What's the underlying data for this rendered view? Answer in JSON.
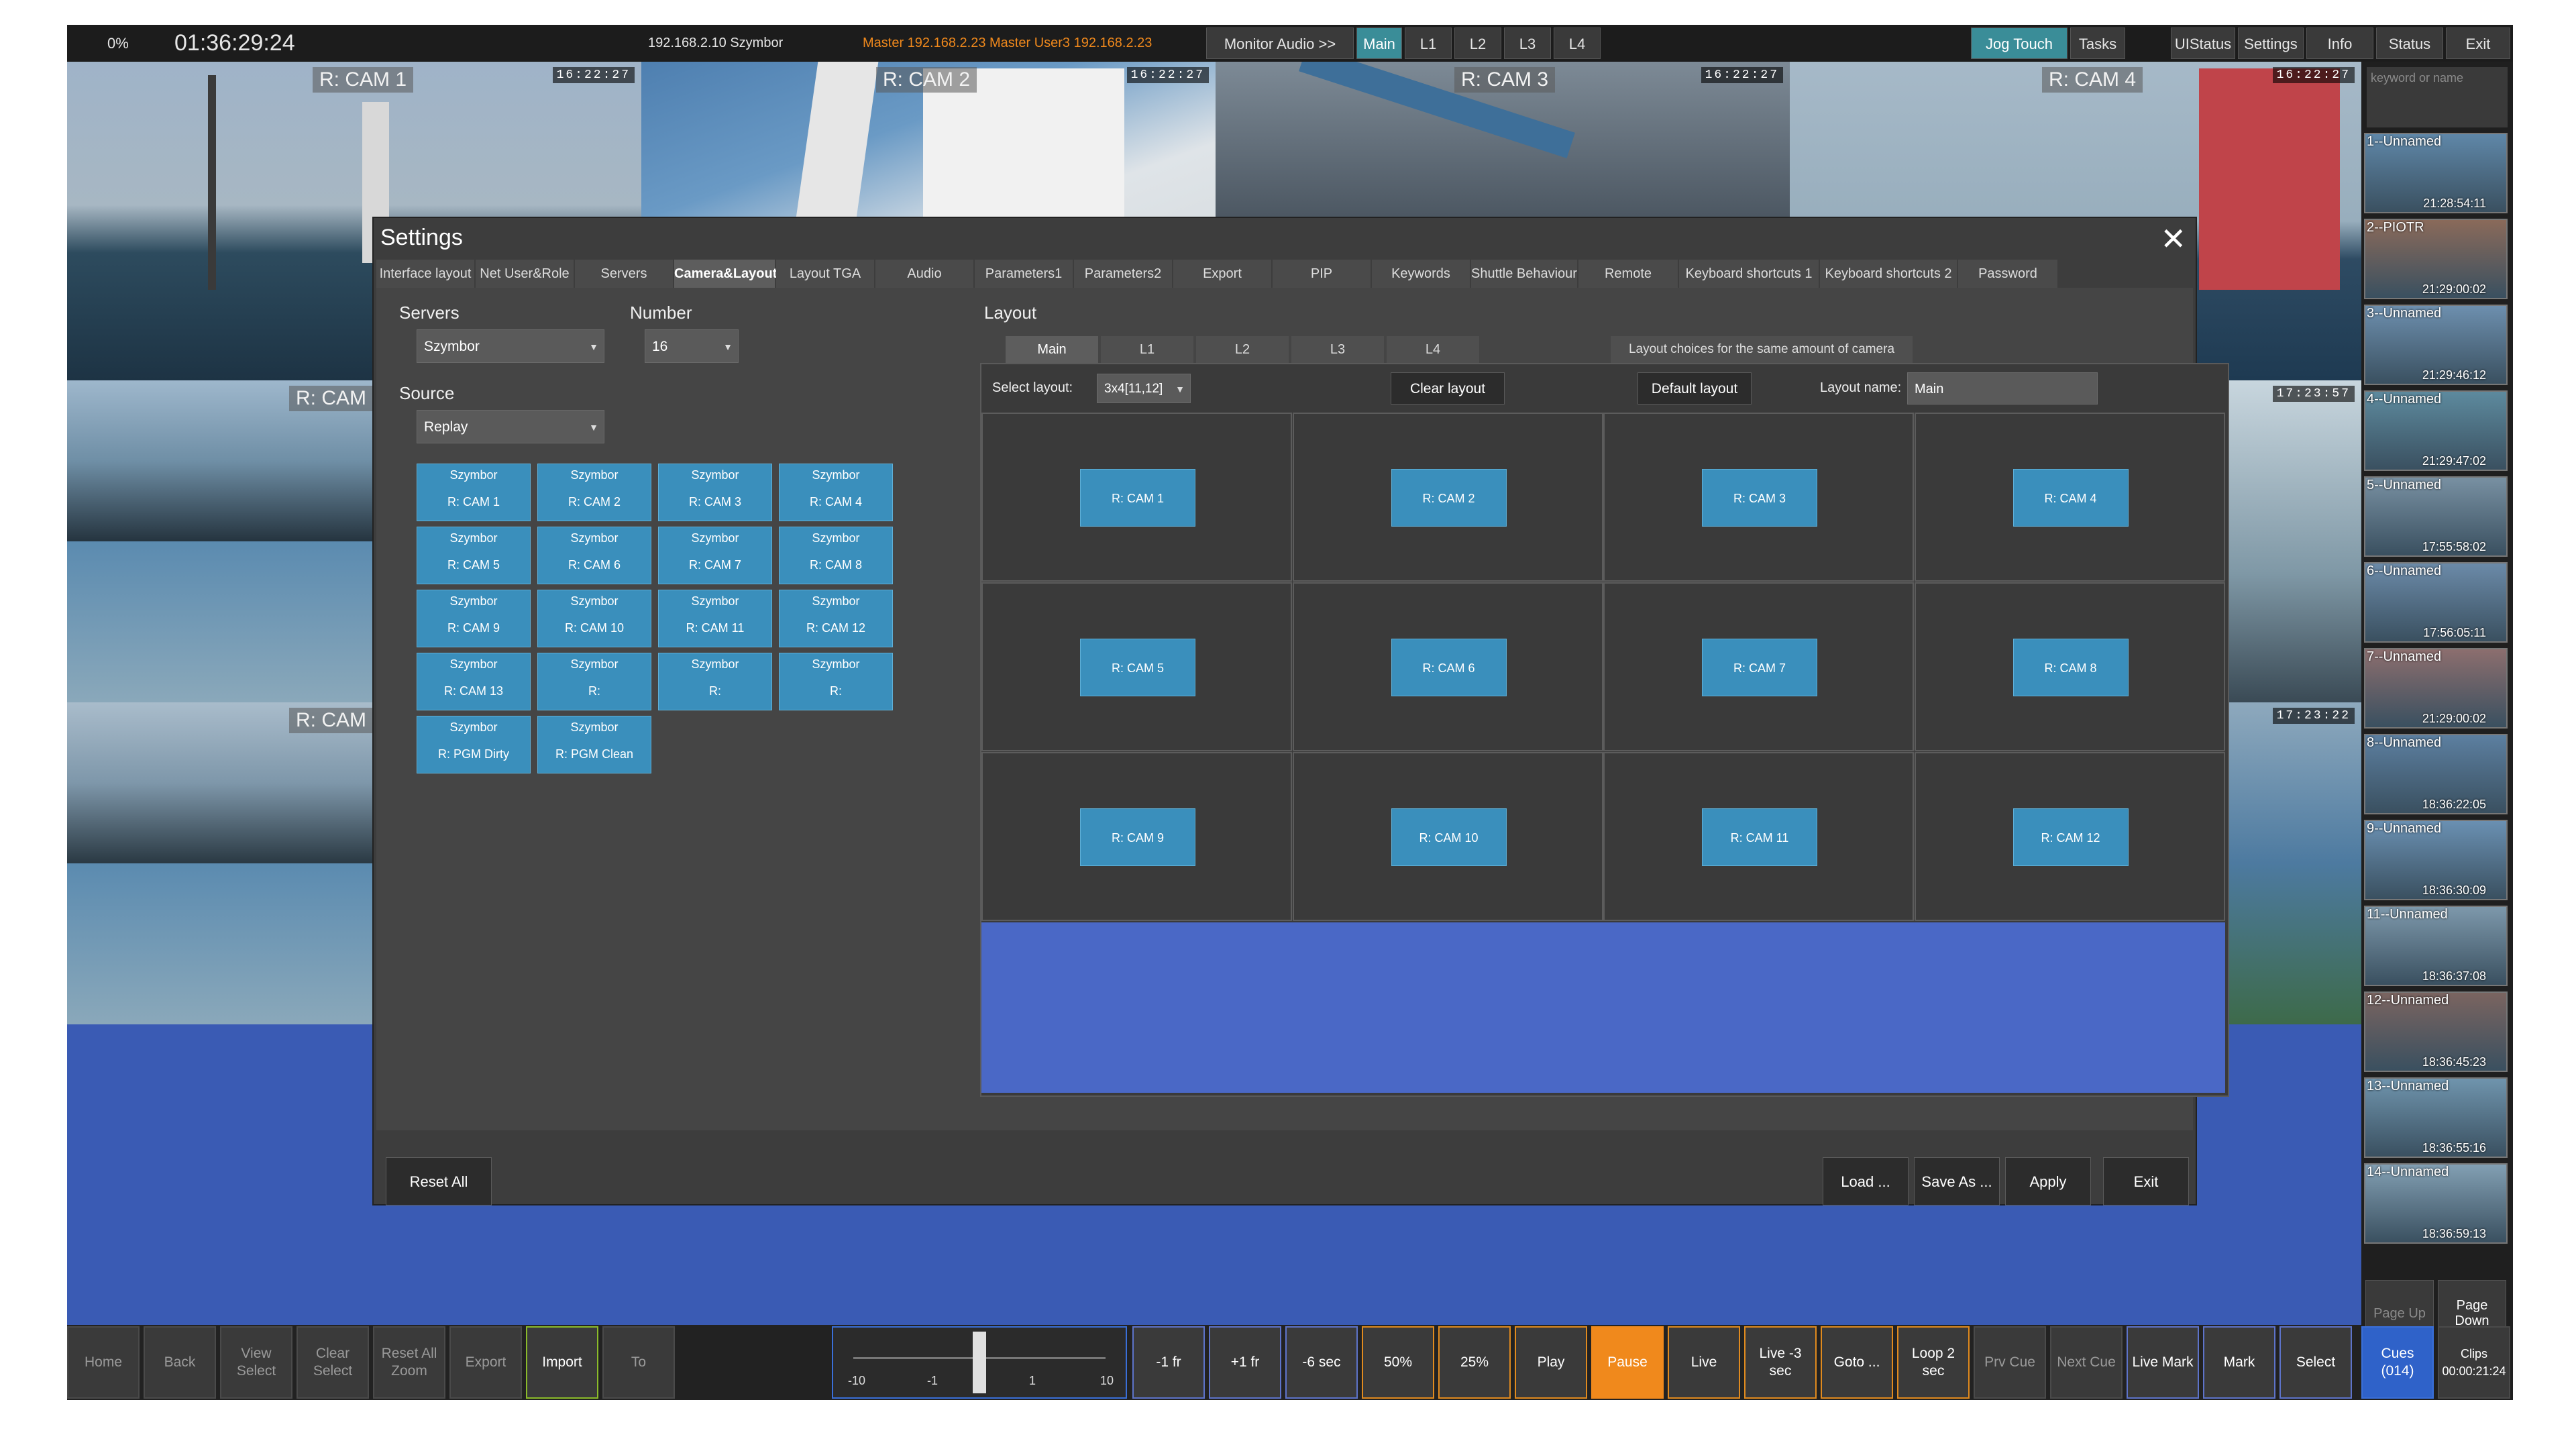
{
  "topbar": {
    "percent": "0%",
    "timecode": "01:36:29:24",
    "server": "192.168.2.10 Szymbor",
    "master": "Master 192.168.2.23  Master  User3  192.168.2.23",
    "buttons": [
      "Monitor Audio >>",
      "Main",
      "L1",
      "L2",
      "L3",
      "L4"
    ],
    "right_buttons": [
      "Jog Touch",
      "Tasks",
      "UIStatus",
      "Settings",
      "Info",
      "Status",
      "Exit"
    ]
  },
  "cameras": {
    "cam1": "R: CAM 1",
    "cam2": "R: CAM 2",
    "cam3": "R: CAM 3",
    "cam4": "R: CAM 4",
    "left_mid": "R: CAM",
    "left_low": "R: CAM",
    "tc1": "16:22:27",
    "tc2": "16:22:27",
    "tc3": "16:22:27",
    "tc4": "16:22:27",
    "tc_r1": "17:23:57",
    "tc_r2": "17:23:22"
  },
  "clips": {
    "keyword_placeholder": "keyword or name",
    "items": [
      {
        "name": "1--Unnamed",
        "time": "21:28:54:11"
      },
      {
        "name": "2--PIOTR",
        "time": "21:29:00:02"
      },
      {
        "name": "3--Unnamed",
        "time": "21:29:46:12"
      },
      {
        "name": "4--Unnamed",
        "time": "21:29:47:02"
      },
      {
        "name": "5--Unnamed",
        "time": "17:55:58:02"
      },
      {
        "name": "6--Unnamed",
        "time": "17:56:05:11"
      },
      {
        "name": "7--Unnamed",
        "time": "21:29:00:02"
      },
      {
        "name": "8--Unnamed",
        "time": "18:36:22:05"
      },
      {
        "name": "9--Unnamed",
        "time": "18:36:30:09"
      },
      {
        "name": "11--Unnamed",
        "time": "18:36:37:08"
      },
      {
        "name": "12--Unnamed",
        "time": "18:36:45:23"
      },
      {
        "name": "13--Unnamed",
        "time": "18:36:55:16"
      },
      {
        "name": "14--Unnamed",
        "time": "18:36:59:13"
      }
    ],
    "page_up": "Page Up",
    "page_down": "Page Down"
  },
  "settings": {
    "title": "Settings",
    "tabs": [
      "Interface layout",
      "Net User&Role",
      "Servers",
      "Camera&Layout",
      "Layout TGA",
      "Audio",
      "Parameters1",
      "Parameters2",
      "Export",
      "PIP",
      "Keywords",
      "Shuttle Behaviour",
      "Remote",
      "Keyboard shortcuts 1",
      "Keyboard shortcuts 2",
      "Password"
    ],
    "active_tab": "Camera&Layout",
    "servers_label": "Servers",
    "servers_value": "Szymbor",
    "number_label": "Number",
    "number_value": "16",
    "source_label": "Source",
    "source_value": "Replay",
    "sources": [
      {
        "server": "Szymbor",
        "cam": "R: CAM 1"
      },
      {
        "server": "Szymbor",
        "cam": "R: CAM 2"
      },
      {
        "server": "Szymbor",
        "cam": "R: CAM 3"
      },
      {
        "server": "Szymbor",
        "cam": "R: CAM 4"
      },
      {
        "server": "Szymbor",
        "cam": "R: CAM 5"
      },
      {
        "server": "Szymbor",
        "cam": "R: CAM 6"
      },
      {
        "server": "Szymbor",
        "cam": "R: CAM 7"
      },
      {
        "server": "Szymbor",
        "cam": "R: CAM 8"
      },
      {
        "server": "Szymbor",
        "cam": "R: CAM 9"
      },
      {
        "server": "Szymbor",
        "cam": "R: CAM 10"
      },
      {
        "server": "Szymbor",
        "cam": "R: CAM 11"
      },
      {
        "server": "Szymbor",
        "cam": "R: CAM 12"
      },
      {
        "server": "Szymbor",
        "cam": "R: CAM 13"
      },
      {
        "server": "Szymbor",
        "cam": "R:"
      },
      {
        "server": "Szymbor",
        "cam": "R:"
      },
      {
        "server": "Szymbor",
        "cam": "R:"
      },
      {
        "server": "Szymbor",
        "cam": "R: PGM Dirty"
      },
      {
        "server": "Szymbor",
        "cam": "R: PGM Clean"
      }
    ],
    "layout_label": "Layout",
    "layout_tabs": [
      "Main",
      "L1",
      "L2",
      "L3",
      "L4"
    ],
    "layout_hint": "Layout choices for the same amount of camera",
    "select_layout_label": "Select layout:",
    "select_layout_value": "3x4[11,12]",
    "clear_layout": "Clear layout",
    "default_layout": "Default layout",
    "layout_name_label": "Layout name:",
    "layout_name_value": "Main",
    "grid": [
      "R: CAM 1",
      "R: CAM 2",
      "R: CAM 3",
      "R: CAM 4",
      "R: CAM 5",
      "R: CAM 6",
      "R: CAM 7",
      "R: CAM 8",
      "R: CAM 9",
      "R: CAM 10",
      "R: CAM 11",
      "R: CAM 12"
    ],
    "reset_all": "Reset All",
    "load": "Load ...",
    "save_as": "Save As ...",
    "apply": "Apply",
    "exit": "Exit"
  },
  "bottombar": {
    "home": "Home",
    "back": "Back",
    "view_select": "View Select",
    "clear_select": "Clear Select",
    "reset_zoom": "Reset All Zoom",
    "export": "Export",
    "import": "Import",
    "to": "To",
    "jog_labels": [
      "-10",
      "-1",
      "1",
      "10"
    ],
    "minus_fr": "-1 fr",
    "plus_fr": "+1 fr",
    "minus6": "-6 sec",
    "p50": "50%",
    "p25": "25%",
    "play": "Play",
    "pause": "Pause",
    "live": "Live",
    "live3": "Live -3 sec",
    "goto": "Goto ...",
    "loop": "Loop 2 sec",
    "prv": "Prv Cue",
    "next": "Next Cue",
    "live_mark": "Live Mark",
    "mark": "Mark",
    "select": "Select",
    "cues": "Cues (014)",
    "clips": "Clips 00:00:21:24"
  }
}
